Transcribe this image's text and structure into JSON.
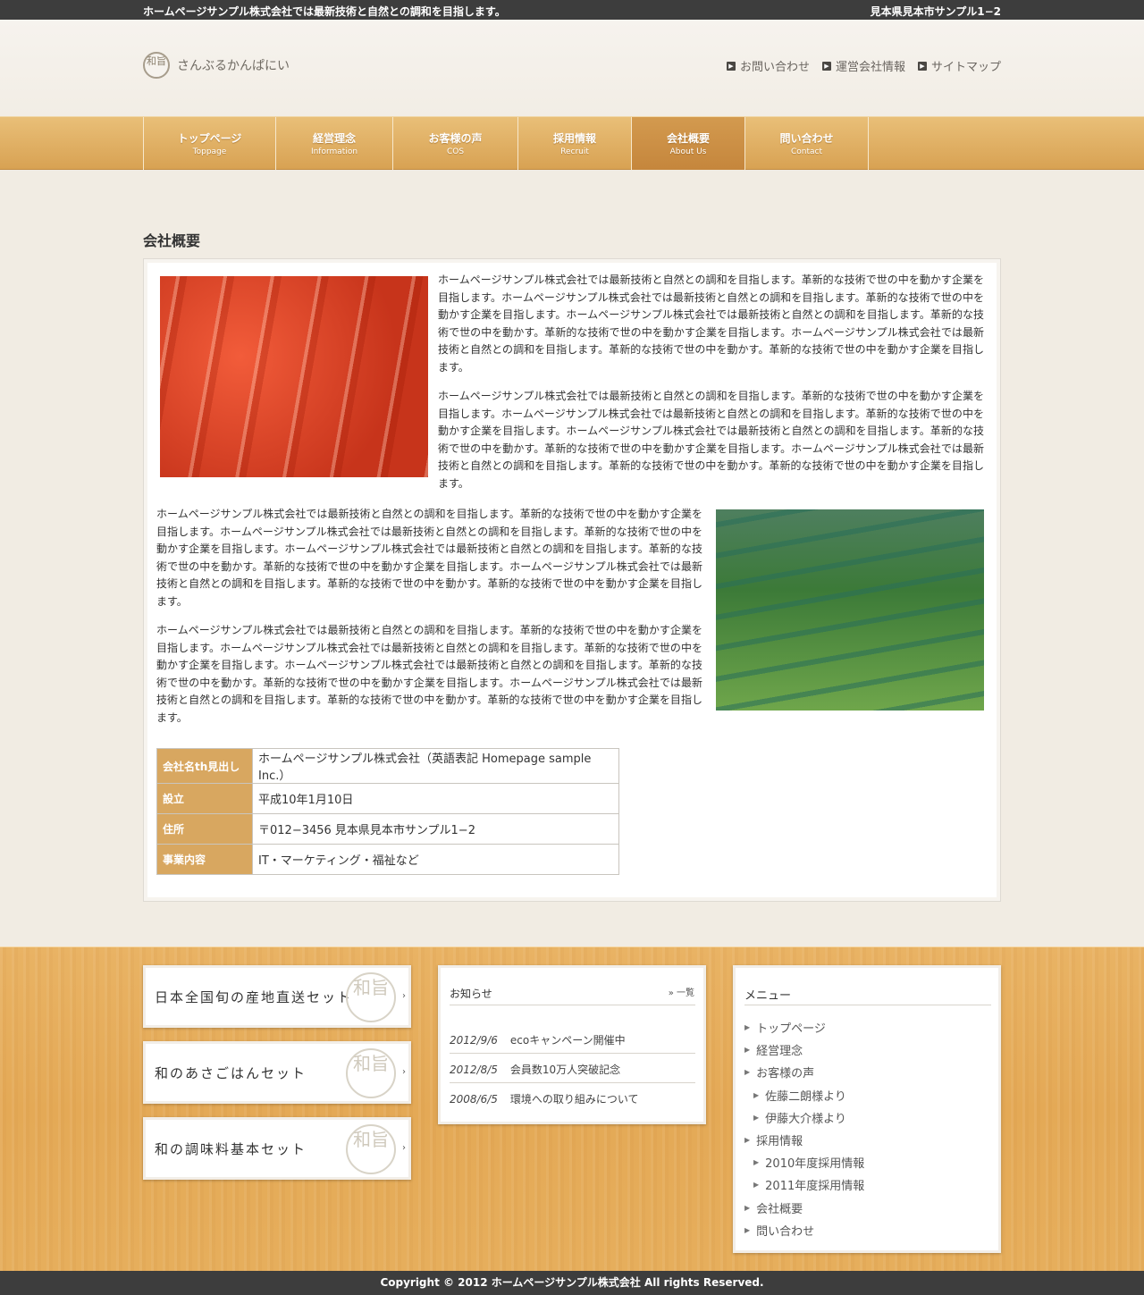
{
  "topbar": {
    "tagline": "ホームページサンプル株式会社では最新技術と自然との調和を目指します。",
    "address": "見本県見本市サンプル1−2"
  },
  "header": {
    "logo_mark": "和旨",
    "logo_text": "さんぶるかんぱにい",
    "links": [
      {
        "label": "お問い合わせ"
      },
      {
        "label": "運営会社情報"
      },
      {
        "label": "サイトマップ"
      }
    ]
  },
  "gnav": [
    {
      "jp": "トップページ",
      "en": "Toppage"
    },
    {
      "jp": "経営理念",
      "en": "Information"
    },
    {
      "jp": "お客様の声",
      "en": "COS"
    },
    {
      "jp": "採用情報",
      "en": "Recruit"
    },
    {
      "jp": "会社概要",
      "en": "About Us"
    },
    {
      "jp": "問い合わせ",
      "en": "Contact"
    }
  ],
  "main": {
    "title": "会社概要",
    "paragraphs": [
      "ホームページサンプル株式会社では最新技術と自然との調和を目指します。革新的な技術で世の中を動かす企業を目指します。ホームページサンプル株式会社では最新技術と自然との調和を目指します。革新的な技術で世の中を動かす企業を目指します。ホームページサンプル株式会社では最新技術と自然との調和を目指します。革新的な技術で世の中を動かす。革新的な技術で世の中を動かす企業を目指します。ホームページサンプル株式会社では最新技術と自然との調和を目指します。革新的な技術で世の中を動かす。革新的な技術で世の中を動かす企業を目指します。",
      "ホームページサンプル株式会社では最新技術と自然との調和を目指します。革新的な技術で世の中を動かす企業を目指します。ホームページサンプル株式会社では最新技術と自然との調和を目指します。革新的な技術で世の中を動かす企業を目指します。ホームページサンプル株式会社では最新技術と自然との調和を目指します。革新的な技術で世の中を動かす。革新的な技術で世の中を動かす企業を目指します。ホームページサンプル株式会社では最新技術と自然との調和を目指します。革新的な技術で世の中を動かす。革新的な技術で世の中を動かす企業を目指します。",
      "ホームページサンプル株式会社では最新技術と自然との調和を目指します。革新的な技術で世の中を動かす企業を目指します。ホームページサンプル株式会社では最新技術と自然との調和を目指します。革新的な技術で世の中を動かす企業を目指します。ホームページサンプル株式会社では最新技術と自然との調和を目指します。革新的な技術で世の中を動かす。革新的な技術で世の中を動かす企業を目指します。ホームページサンプル株式会社では最新技術と自然との調和を目指します。革新的な技術で世の中を動かす。革新的な技術で世の中を動かす企業を目指します。",
      "ホームページサンプル株式会社では最新技術と自然との調和を目指します。革新的な技術で世の中を動かす企業を目指します。ホームページサンプル株式会社では最新技術と自然との調和を目指します。革新的な技術で世の中を動かす企業を目指します。ホームページサンプル株式会社では最新技術と自然との調和を目指します。革新的な技術で世の中を動かす。革新的な技術で世の中を動かす企業を目指します。ホームページサンプル株式会社では最新技術と自然との調和を目指します。革新的な技術で世の中を動かす。革新的な技術で世の中を動かす企業を目指します。"
    ],
    "table": [
      {
        "th": "会社名th見出し",
        "td": "ホームページサンプル株式会社（英語表記 Homepage sample Inc.）"
      },
      {
        "th": "設立",
        "td": "平成10年1月10日"
      },
      {
        "th": "住所",
        "td": "〒012−3456 見本県見本市サンプル1−2"
      },
      {
        "th": "事業内容",
        "td": "IT・マーケティング・福祉など"
      }
    ]
  },
  "banners": [
    {
      "label": "日本全国旬の産地直送セット",
      "seal": "和旨"
    },
    {
      "label": "和のあさごはんセット",
      "seal": "和旨"
    },
    {
      "label": "和の調味料基本セット",
      "seal": "和旨"
    }
  ],
  "news": {
    "title": "お知らせ",
    "more": "一覧",
    "items": [
      {
        "date": "2012/9/6",
        "text": "ecoキャンペーン開催中"
      },
      {
        "date": "2012/8/5",
        "text": "会員数10万人突破記念"
      },
      {
        "date": "2008/6/5",
        "text": "環境への取り組みについて"
      }
    ]
  },
  "menu": {
    "title": "メニュー",
    "items": [
      {
        "label": "トップページ"
      },
      {
        "label": "経営理念"
      },
      {
        "label": "お客様の声"
      },
      {
        "label": "佐藤二朗様より"
      },
      {
        "label": "伊藤大介様より"
      },
      {
        "label": "採用情報"
      },
      {
        "label": "2010年度採用情報"
      },
      {
        "label": "2011年度採用情報"
      },
      {
        "label": "会社概要"
      },
      {
        "label": "問い合わせ"
      }
    ]
  },
  "footer": {
    "copyright": "Copyright © 2012 ホームページサンプル株式会社 All rights Reserved."
  }
}
